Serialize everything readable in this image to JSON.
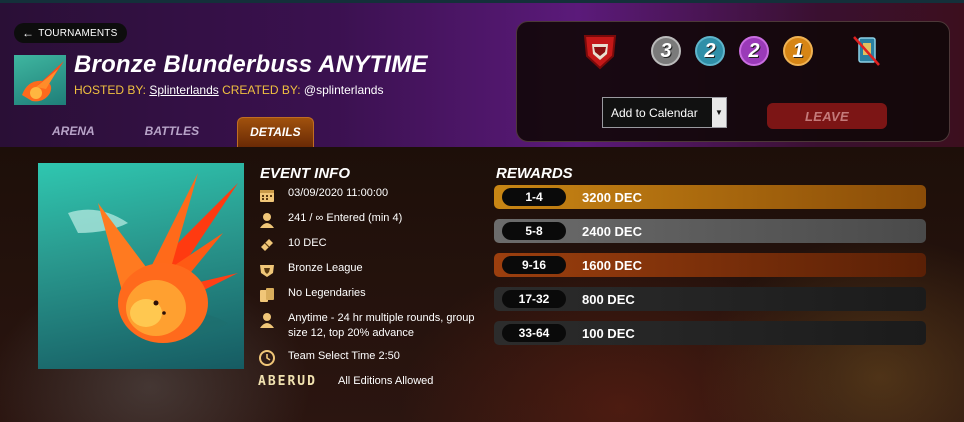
{
  "header": {
    "back_label": "TOURNAMENTS",
    "title": "Bronze Blunderbuss ANYTIME",
    "hosted_by_label": "HOSTED BY:",
    "hosted_by": "Splinterlands",
    "created_by_label": "CREATED BY:",
    "created_by": "@splinterlands"
  },
  "tabs": [
    {
      "label": "ARENA",
      "active": false
    },
    {
      "label": "BATTLES",
      "active": false
    },
    {
      "label": "DETAILS",
      "active": true
    }
  ],
  "panel": {
    "badges": [
      {
        "icon": "league-shield-icon"
      },
      {
        "value": "3",
        "color": "#7a7a7a",
        "name": "common-limit"
      },
      {
        "value": "2",
        "color": "#2f8fa8",
        "name": "rare-limit"
      },
      {
        "value": "2",
        "color": "#9a3ab8",
        "name": "epic-limit"
      },
      {
        "value": "1",
        "color": "#d68515",
        "name": "legendary-limit"
      },
      {
        "icon": "no-legendary-icon"
      }
    ],
    "calendar_select": "Add to Calendar",
    "leave_label": "LEAVE"
  },
  "event_info": {
    "title": "EVENT INFO",
    "items": [
      {
        "icon": "calendar-icon",
        "text": "03/09/2020 11:00:00"
      },
      {
        "icon": "person-icon",
        "text": "241 / ∞ Entered (min 4)"
      },
      {
        "icon": "ticket-icon",
        "text": "10 DEC"
      },
      {
        "icon": "league-icon",
        "text": "Bronze League"
      },
      {
        "icon": "cards-icon",
        "text": "No Legendaries"
      },
      {
        "icon": "person-icon",
        "text": "Anytime - 24 hr multiple rounds, group size 12, top 20% advance"
      },
      {
        "icon": "clock-icon",
        "text": "Team Select Time 2:50"
      }
    ],
    "editions_logo": "ABERUD",
    "editions_text": "All Editions Allowed"
  },
  "rewards": {
    "title": "REWARDS",
    "rows": [
      {
        "rank": "1-4",
        "amount": "3200 DEC",
        "tier": "gold"
      },
      {
        "rank": "5-8",
        "amount": "2400 DEC",
        "tier": "silver"
      },
      {
        "rank": "9-16",
        "amount": "1600 DEC",
        "tier": "bronze"
      },
      {
        "rank": "17-32",
        "amount": "800 DEC",
        "tier": "dark"
      },
      {
        "rank": "33-64",
        "amount": "100 DEC",
        "tier": "dark"
      }
    ]
  }
}
